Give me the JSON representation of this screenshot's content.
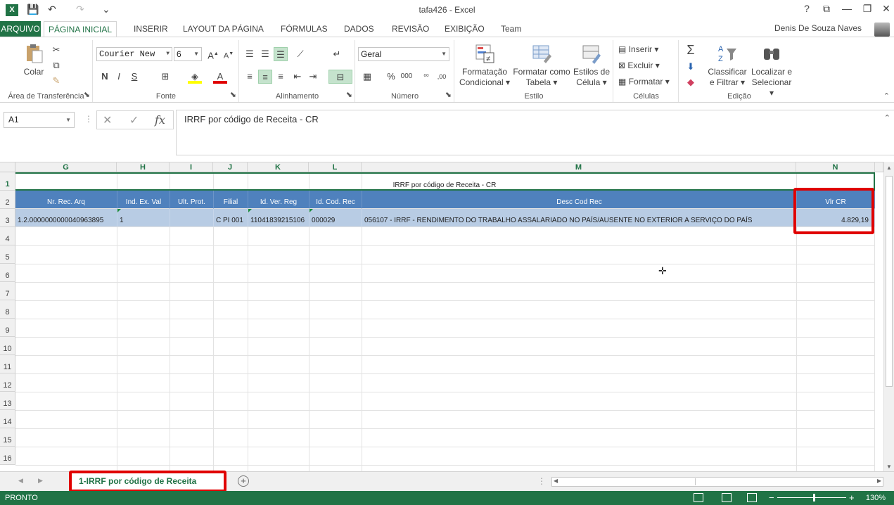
{
  "window": {
    "title": "tafa426 - Excel",
    "user": "Denis De Souza Naves",
    "help": "?",
    "min": "—",
    "restore": "❐",
    "close": "✕",
    "ribbon_opts": "⧉"
  },
  "quick_access": {
    "save": "💾",
    "undo": "↶",
    "redo": "↷",
    "customize": "⌄"
  },
  "tabs": [
    {
      "label": "ARQUIVO"
    },
    {
      "label": "PÁGINA INICIAL"
    },
    {
      "label": "INSERIR"
    },
    {
      "label": "LAYOUT DA PÁGINA"
    },
    {
      "label": "FÓRMULAS"
    },
    {
      "label": "DADOS"
    },
    {
      "label": "REVISÃO"
    },
    {
      "label": "EXIBIÇÃO"
    },
    {
      "label": "Team"
    }
  ],
  "ribbon": {
    "clipboard": {
      "label": "Área de Transferência",
      "paste": "Colar"
    },
    "font": {
      "label": "Fonte",
      "name": "Courier New",
      "size": "6",
      "bold": "N",
      "italic": "I",
      "underline": "S"
    },
    "alignment": {
      "label": "Alinhamento"
    },
    "number": {
      "label": "Número",
      "format": "Geral",
      "percent": "%",
      "thousands": "000",
      "inc": "⁰⁰",
      "dec": ",00"
    },
    "styles": {
      "label": "Estilo",
      "conditional1": "Formatação",
      "conditional2": "Condicional",
      "table1": "Formatar como",
      "table2": "Tabela",
      "cell1": "Estilos de",
      "cell2": "Célula"
    },
    "cells": {
      "label": "Células",
      "insert": "Inserir",
      "delete": "Excluir",
      "format": "Formatar"
    },
    "editing": {
      "label": "Edição",
      "sort1": "Classificar",
      "sort2": "e Filtrar",
      "find1": "Localizar e",
      "find2": "Selecionar"
    }
  },
  "formula_bar": {
    "name_box": "A1",
    "content": "IRRF por código de Receita - CR"
  },
  "columns": [
    "G",
    "H",
    "I",
    "J",
    "K",
    "L",
    "M",
    "N"
  ],
  "rows": [
    "1",
    "2",
    "3",
    "4",
    "5",
    "6",
    "7",
    "8",
    "9",
    "10",
    "11",
    "12",
    "13",
    "14",
    "15",
    "16"
  ],
  "sheet": {
    "title": "IRRF por código de Receita - CR",
    "headers": [
      "Nr. Rec. Arq",
      "Ind. Ex. Val",
      "Ult. Prot.",
      "Filial",
      "Id. Ver. Reg",
      "Id. Cod. Rec",
      "Desc Cod Rec",
      "Vlr CR"
    ],
    "row3": [
      "1.2.0000000000040963895",
      "1",
      "",
      "C PI 001",
      "11041839215106",
      "000029",
      "056107   - IRRF - RENDIMENTO DO TRABALHO ASSALARIADO NO PAÍS/AUSENTE NO EXTERIOR A SERVIÇO DO PAÍS",
      "4.829,19"
    ]
  },
  "sheet_tab": {
    "label": "1-IRRF por código de Receita"
  },
  "status": {
    "ready": "PRONTO",
    "zoom": "130%"
  }
}
